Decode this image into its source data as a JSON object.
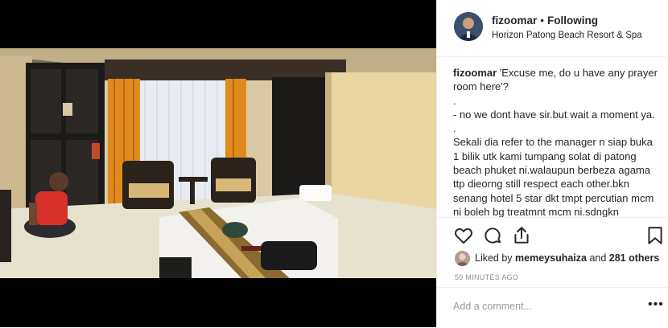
{
  "header": {
    "username": "fizoomar",
    "separator": "•",
    "follow_status": "Following",
    "location": "Horizon Patong Beach Resort & Spa"
  },
  "caption": {
    "username": "fizoomar",
    "text": " 'Excuse me, do u have any prayer room here'?\n.\n- no we dont have sir.but wait a moment ya.\n.\nSekali dia refer to the manager n siap buka 1 bilik utk kami tumpang solat di patong beach phuket ni.walaupun berbeza agama ttp dieorng still respect each other.bkn senang hotel 5 star dkt tmpt percutian mcm ni boleh bg treatmnt mcm ni.sdngkn"
  },
  "actions": {
    "icons": [
      "heart-icon",
      "comment-icon",
      "share-icon",
      "bookmark-icon"
    ]
  },
  "likes": {
    "prefix": "Liked by ",
    "user": "memeysuhaiza",
    "middle": " and ",
    "others": "281 others"
  },
  "timestamp": "59 MINUTES AGO",
  "comment": {
    "placeholder": "Add a comment...",
    "more_label": "•••"
  },
  "colors": {
    "text": "#262626",
    "muted": "#8e8e8e",
    "border": "#efefef",
    "media_bg": "#000000"
  }
}
